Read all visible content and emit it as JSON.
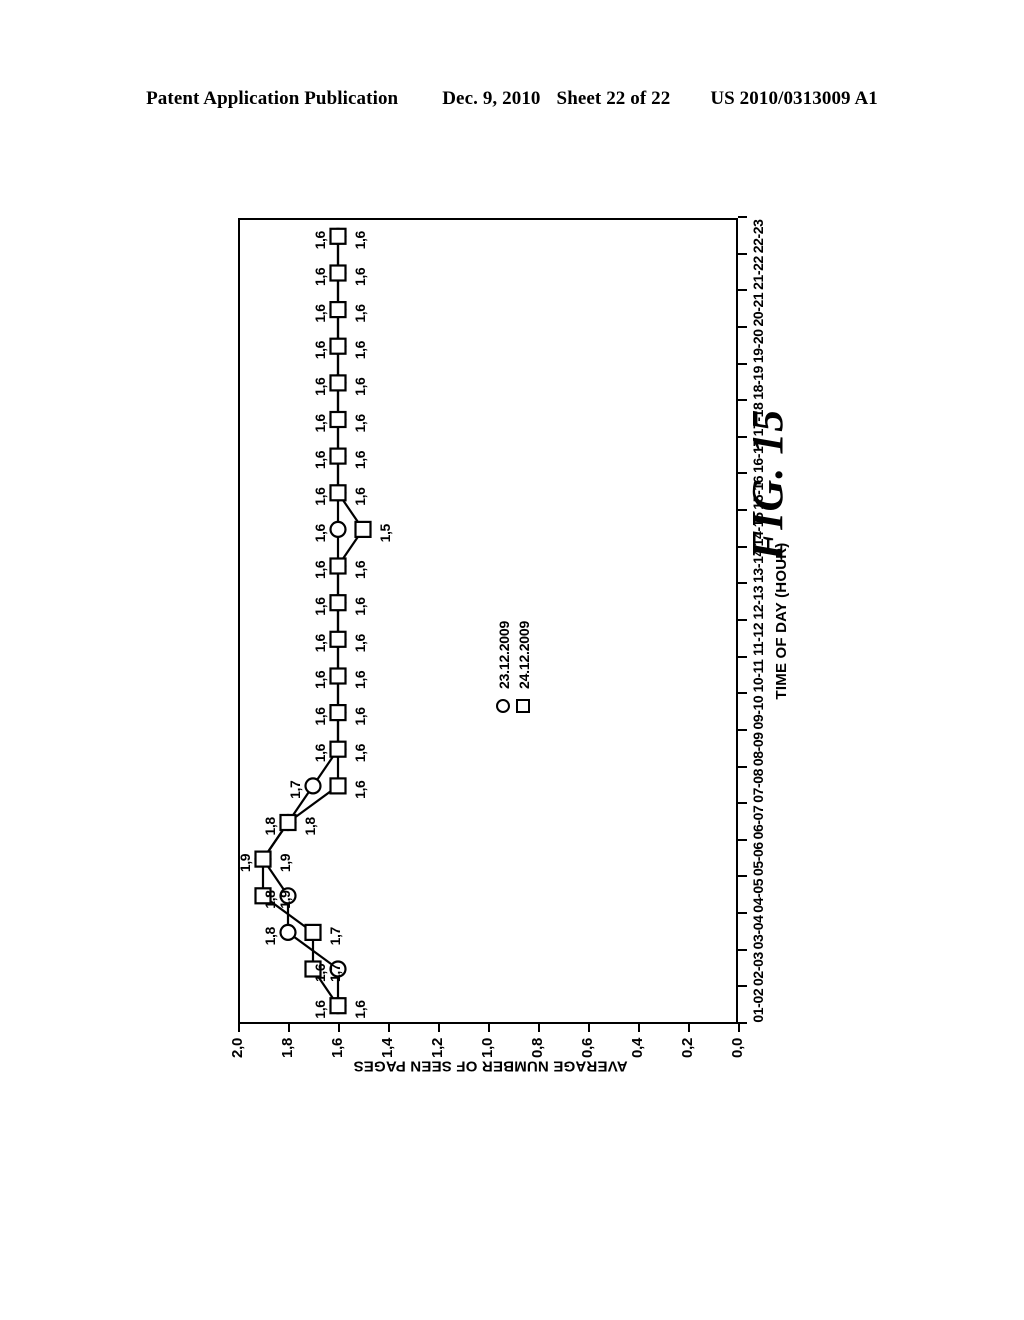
{
  "header": {
    "publication": "Patent Application Publication",
    "date": "Dec. 9, 2010",
    "sheet": "Sheet 22 of 22",
    "patent_number": "US 2010/0313009 A1"
  },
  "figure": {
    "caption": "FIG. 15"
  },
  "chart_data": {
    "type": "line",
    "title": "",
    "xlabel": "TIME OF DAY (HOUR)",
    "ylabel": "AVERAGE NUMBER OF SEEN PAGES",
    "ylim": [
      0.0,
      2.0
    ],
    "y_ticks": [
      "0,0",
      "0,2",
      "0,4",
      "0,6",
      "0,8",
      "1,0",
      "1,2",
      "1,4",
      "1,6",
      "1,8",
      "2,0"
    ],
    "y_tick_values": [
      0.0,
      0.2,
      0.4,
      0.6,
      0.8,
      1.0,
      1.2,
      1.4,
      1.6,
      1.8,
      2.0
    ],
    "grid": false,
    "legend_position": "center",
    "orientation": "rotated-90",
    "categories": [
      "01-02",
      "02-03",
      "03-04",
      "04-05",
      "05-06",
      "06-07",
      "07-08",
      "08-09",
      "09-10",
      "10-11",
      "11-12",
      "12-13",
      "13-14",
      "14-15",
      "15-16",
      "16-17",
      "17-18",
      "18-19",
      "19-20",
      "20-21",
      "21-22",
      "22-23"
    ],
    "series": [
      {
        "name": "23.12.2009",
        "marker": "circle",
        "values": [
          1.6,
          1.6,
          1.8,
          1.8,
          1.9,
          1.8,
          1.7,
          1.6,
          1.6,
          1.6,
          1.6,
          1.6,
          1.6,
          1.6,
          1.6,
          1.6,
          1.6,
          1.6,
          1.6,
          1.6,
          1.6,
          1.6
        ],
        "labels": [
          "1,6",
          "1,6",
          "1,8",
          "1,8",
          "1,9",
          "1,8",
          "1,7",
          "1,6",
          "1,6",
          "1,6",
          "1,6",
          "1,6",
          "1,6",
          "1,6",
          "1,6",
          "1,6",
          "1,6",
          "1,6",
          "1,6",
          "1,6",
          "1,6",
          "1,6"
        ]
      },
      {
        "name": "24.12.2009",
        "marker": "square",
        "values": [
          1.6,
          1.7,
          1.7,
          1.9,
          1.9,
          1.8,
          1.6,
          1.6,
          1.6,
          1.6,
          1.6,
          1.6,
          1.6,
          1.5,
          1.6,
          1.6,
          1.6,
          1.6,
          1.6,
          1.6,
          1.6,
          1.6
        ],
        "labels": [
          "1,6",
          "1,7",
          "1,7",
          "1,9",
          "1,9",
          "1,8",
          "1,6",
          "1,6",
          "1,6",
          "1,6",
          "1,6",
          "1,6",
          "1,6",
          "1,5",
          "1,6",
          "1,6",
          "1,6",
          "1,6",
          "1,6",
          "1,6",
          "1,6",
          "1,6"
        ]
      }
    ],
    "legend": [
      {
        "marker": "circle",
        "label": "23.12.2009"
      },
      {
        "marker": "square",
        "label": "24.12.2009"
      }
    ]
  }
}
